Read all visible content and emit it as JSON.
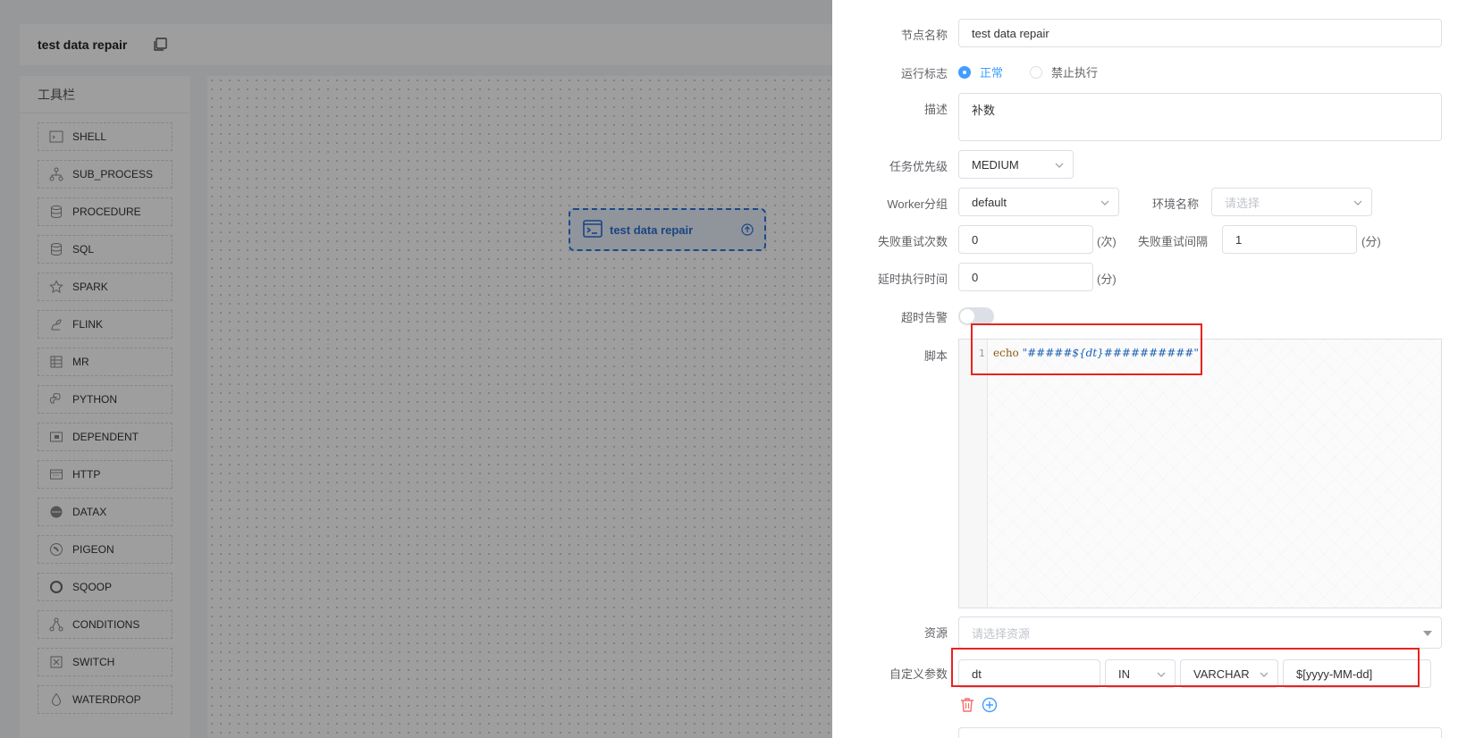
{
  "editor": {
    "title": "test data repair",
    "toolbar_title": "工具栏",
    "tools": [
      {
        "label": "SHELL",
        "icon": "terminal-icon"
      },
      {
        "label": "SUB_PROCESS",
        "icon": "subprocess-icon"
      },
      {
        "label": "PROCEDURE",
        "icon": "database-icon"
      },
      {
        "label": "SQL",
        "icon": "database-icon"
      },
      {
        "label": "SPARK",
        "icon": "star-icon"
      },
      {
        "label": "FLINK",
        "icon": "squirrel-icon"
      },
      {
        "label": "MR",
        "icon": "table-icon"
      },
      {
        "label": "PYTHON",
        "icon": "python-icon"
      },
      {
        "label": "DEPENDENT",
        "icon": "dependent-icon"
      },
      {
        "label": "HTTP",
        "icon": "http-icon"
      },
      {
        "label": "DATAX",
        "icon": "datax-icon"
      },
      {
        "label": "PIGEON",
        "icon": "pigeon-icon"
      },
      {
        "label": "SQOOP",
        "icon": "circle-icon"
      },
      {
        "label": "CONDITIONS",
        "icon": "conditions-icon"
      },
      {
        "label": "SWITCH",
        "icon": "switch-icon"
      },
      {
        "label": "WATERDROP",
        "icon": "drop-icon"
      }
    ],
    "node_label": "test data repair"
  },
  "form": {
    "node_name": {
      "label": "节点名称",
      "value": "test data repair"
    },
    "run_flag": {
      "label": "运行标志",
      "options": [
        "正常",
        "禁止执行"
      ],
      "selected": "正常"
    },
    "description": {
      "label": "描述",
      "value": "补数"
    },
    "priority": {
      "label": "任务优先级",
      "value": "MEDIUM"
    },
    "worker_group": {
      "label": "Worker分组",
      "value": "default"
    },
    "environment": {
      "label": "环境名称",
      "placeholder": "请选择"
    },
    "retry_times": {
      "label": "失败重试次数",
      "value": "0",
      "unit": "(次)"
    },
    "retry_interval": {
      "label": "失败重试间隔",
      "value": "1",
      "unit": "(分)"
    },
    "delay_time": {
      "label": "延时执行时间",
      "value": "0",
      "unit": "(分)"
    },
    "timeout_alert": {
      "label": "超时告警",
      "enabled": false
    },
    "script": {
      "label": "脚本",
      "line_number": "1",
      "keyword": "echo",
      "string": "\"#####${dt}##########\""
    },
    "resources": {
      "label": "资源",
      "placeholder": "请选择资源"
    },
    "custom_params": {
      "label": "自定义参数",
      "prop": "dt",
      "direction": "IN",
      "type": "VARCHAR",
      "value": "$[yyyy-MM-dd]"
    }
  },
  "colors": {
    "accent": "#409eff",
    "highlight": "#e8231f",
    "danger": "#f56c6c"
  }
}
